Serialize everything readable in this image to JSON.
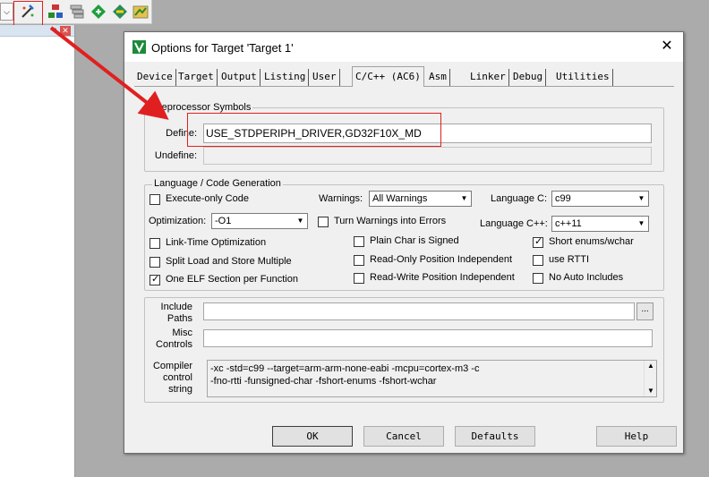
{
  "toolbar": {
    "dropdown_glyph": "⌵",
    "icons": [
      "options-for-target-icon",
      "manage-project-items-icon",
      "batch-build-icon",
      "select-packs-icon",
      "manage-run-time-environment-icon",
      "pack-installer-icon"
    ]
  },
  "left_panel": {
    "pin_glyph": "ᵖ",
    "close_glyph": "✕"
  },
  "dialog": {
    "title": "Options for Target 'Target 1'",
    "close_glyph": "✕",
    "tabs": [
      {
        "label": "Device"
      },
      {
        "label": "Target"
      },
      {
        "label": "Output"
      },
      {
        "label": "Listing"
      },
      {
        "label": "User"
      },
      {
        "label": "C/C++ (AC6)"
      },
      {
        "label": "Asm"
      },
      {
        "label": "Linker"
      },
      {
        "label": "Debug"
      },
      {
        "label": "Utilities"
      }
    ],
    "active_tab": "C/C++ (AC6)",
    "preprocessor": {
      "group_label": "reprocessor Symbols",
      "define_label": "Define:",
      "define_value": "USE_STDPERIPH_DRIVER,GD32F10X_MD",
      "undefine_label": "Undefine:",
      "undefine_value": ""
    },
    "language": {
      "group_label": "Language / Code Generation",
      "execute_only": {
        "label": "Execute-only Code",
        "checked": false
      },
      "warnings_label": "Warnings:",
      "warnings_value": "All Warnings",
      "language_c_label": "Language C:",
      "language_c_value": "c99",
      "optimization_label": "Optimization:",
      "optimization_value": "-O1",
      "turn_warnings": {
        "label": "Turn Warnings into Errors",
        "checked": false
      },
      "language_cpp_label": "Language C++:",
      "language_cpp_value": "c++11",
      "link_time": {
        "label": "Link-Time Optimization",
        "checked": false
      },
      "plain_char": {
        "label": "Plain Char is Signed",
        "checked": false
      },
      "short_enums": {
        "label": "Short enums/wchar",
        "checked": true
      },
      "split_load": {
        "label": "Split Load and Store Multiple",
        "checked": false
      },
      "read_only_pi": {
        "label": "Read-Only Position Independent",
        "checked": false
      },
      "use_rtti": {
        "label": "use RTTI",
        "checked": false
      },
      "one_elf": {
        "label": "One ELF Section per Function",
        "checked": true
      },
      "read_write_pi": {
        "label": "Read-Write Position Independent",
        "checked": false
      },
      "no_auto_includes": {
        "label": "No Auto Includes",
        "checked": false
      }
    },
    "include_paths": {
      "label_line1": "Include",
      "label_line2": "Paths",
      "value": "",
      "browse_label": "..."
    },
    "misc_controls": {
      "label_line1": "Misc",
      "label_line2": "Controls",
      "value": ""
    },
    "compiler_control": {
      "label_line1": "Compiler",
      "label_line2": "control",
      "label_line3": "string",
      "line1": "-xc -std=c99 --target=arm-arm-none-eabi -mcpu=cortex-m3 -c",
      "line2": "-fno-rtti -funsigned-char -fshort-enums -fshort-wchar"
    },
    "buttons": {
      "ok": "OK",
      "cancel": "Cancel",
      "defaults": "Defaults",
      "help": "Help"
    },
    "check_glyph": "✓",
    "arrow_glyph": "▼"
  },
  "colors": {
    "annotation_red": "#e02020",
    "dialog_bg": "#f0f0f0",
    "workspace_bg": "#ababab"
  }
}
